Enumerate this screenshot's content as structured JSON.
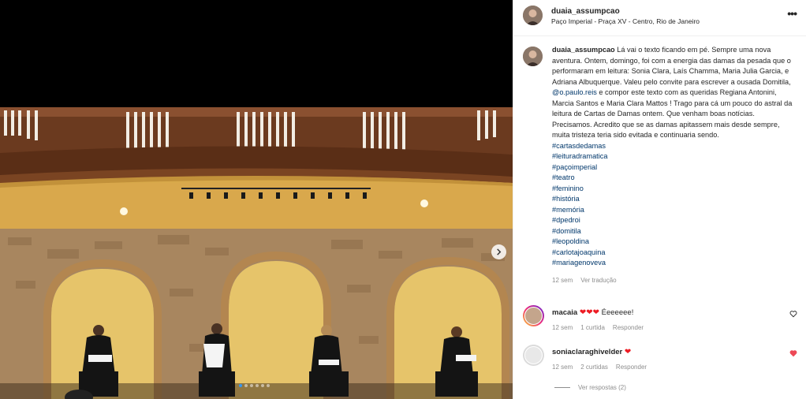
{
  "post": {
    "username": "duaia_assumpcao",
    "location": "Paço Imperial - Praça XV - Centro, Rio de Janeiro",
    "more_icon": "more-horizontal-icon",
    "caption": {
      "username": "duaia_assumpcao",
      "text_before_mention": "Lá vai o texto ficando em pé. Sempre uma nova aventura. Ontem, domingo, foi com a energia das damas da pesada que o performaram em leitura: Sonia Clara, Laís Chamma, Maria Julia Garcia, e Adriana Albuquerque. Valeu pelo convite para escrever a ousada Domitila,",
      "mention": "@o.paulo.reis",
      "text_after_mention": "e compor este texto com as queridas Regiana Antonini, Marcia Santos e Maria Clara Mattos ! Trago para cá um pouco do astral da leitura de Cartas de Damas ontem. Que venham boas notícias. Precisamos. Acredito que se as damas apitassem mais desde sempre, muita tristeza teria sido evitada e continuaria sendo.",
      "hashtags": [
        "#cartasdedamas",
        "#leituradramatica",
        "#paçoimperial",
        "#teatro",
        "#feminino",
        "#história",
        "#memória",
        "#dpedroi",
        "#domitila",
        "#leopoldina",
        "#carlotajoaquina",
        "#mariagenoveva"
      ],
      "time": "12 sem",
      "translate": "Ver tradução"
    },
    "carousel": {
      "current_index": 0,
      "count": 6,
      "next_icon": "chevron-right-icon"
    }
  },
  "comments": [
    {
      "username": "macaia",
      "text": "Éeeeeee!",
      "emoji": "❤❤❤",
      "time": "12 sem",
      "likes": "1 curtida",
      "reply": "Responder",
      "liked": false
    },
    {
      "username": "soniaclaraghivelder",
      "text": "",
      "emoji": "❤",
      "time": "12 sem",
      "likes": "2 curtidas",
      "reply": "Responder",
      "liked": true
    }
  ],
  "view_replies": "Ver respostas (2)",
  "colors": {
    "link": "#00376b",
    "heart": "#ed4956",
    "active_dot": "#3797f0"
  }
}
